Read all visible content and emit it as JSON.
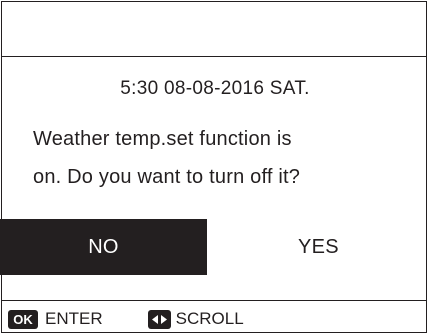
{
  "header": {
    "datetime": "5:30  08-08-2016 SAT."
  },
  "dialog": {
    "message_line1": "Weather temp.set function is",
    "message_line2": "on. Do you want to turn off it?"
  },
  "options": {
    "no_label": "NO",
    "yes_label": "YES",
    "selected": "NO"
  },
  "footer": {
    "ok_key": "OK",
    "ok_label": "ENTER",
    "scroll_key_icon": "left-right-arrows-icon",
    "scroll_label": "SCROLL"
  },
  "colors": {
    "foreground": "#231f20",
    "background": "#ffffff",
    "selected_bg": "#231f20",
    "selected_fg": "#ffffff"
  }
}
